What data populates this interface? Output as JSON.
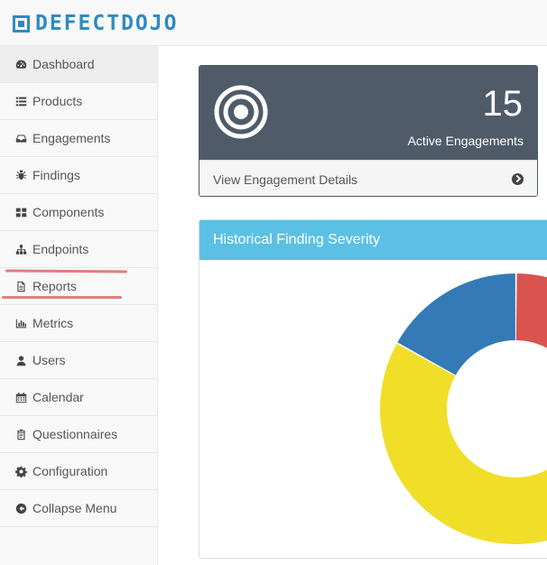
{
  "brand": {
    "name": "DEFECTDOJO",
    "color": "#2e8bc0"
  },
  "sidebar": {
    "items": [
      {
        "label": "Dashboard",
        "icon": "dashboard-icon",
        "active": true
      },
      {
        "label": "Products",
        "icon": "list-icon"
      },
      {
        "label": "Engagements",
        "icon": "inbox-icon"
      },
      {
        "label": "Findings",
        "icon": "bug-icon"
      },
      {
        "label": "Components",
        "icon": "grid-icon"
      },
      {
        "label": "Endpoints",
        "icon": "sitemap-icon"
      },
      {
        "label": "Reports",
        "icon": "file-icon"
      },
      {
        "label": "Metrics",
        "icon": "bar-chart-icon"
      },
      {
        "label": "Users",
        "icon": "user-icon"
      },
      {
        "label": "Calendar",
        "icon": "calendar-icon"
      },
      {
        "label": "Questionnaires",
        "icon": "clipboard-icon"
      },
      {
        "label": "Configuration",
        "icon": "gear-icon"
      },
      {
        "label": "Collapse Menu",
        "icon": "arrow-circle-left-icon"
      }
    ]
  },
  "engagements_panel": {
    "count": "15",
    "label": "Active Engagements",
    "footer": "View Engagement Details",
    "color": "#4f5b69"
  },
  "severity_panel": {
    "title": "Historical Finding Severity",
    "color": "#5bc0e4"
  },
  "chart_data": {
    "type": "pie",
    "donut": true,
    "slices": [
      {
        "value": 0.16,
        "color": "#d9534f"
      },
      {
        "value": 0.67,
        "color": "#f0de28"
      },
      {
        "value": 0.17,
        "color": "#337ab7"
      }
    ]
  }
}
